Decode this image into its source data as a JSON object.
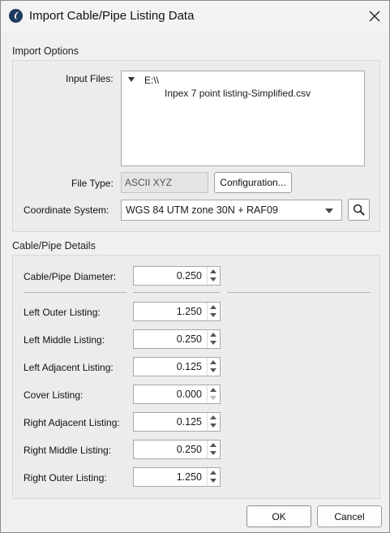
{
  "window": {
    "title": "Import Cable/Pipe Listing Data",
    "icon": "app-logo-icon",
    "close_icon": "close-icon"
  },
  "import_options": {
    "group_label": "Import Options",
    "input_files_label": "Input Files:",
    "tree": {
      "root": "E:\\\\",
      "file": "Inpex 7 point listing-Simplified.csv",
      "expander_icon": "tree-expanded-icon"
    },
    "file_type_label": "File Type:",
    "file_type_value": "ASCII XYZ",
    "configuration_button": "Configuration...",
    "coordinate_system_label": "Coordinate System:",
    "coordinate_system_value": "WGS 84 UTM zone 30N + RAF09",
    "search_icon": "search-icon"
  },
  "cable_details": {
    "group_label": "Cable/Pipe Details",
    "diameter": {
      "label": "Cable/Pipe Diameter:",
      "value": "0.250"
    },
    "fields": [
      {
        "label": "Left Outer Listing:",
        "value": "1.250"
      },
      {
        "label": "Left Middle Listing:",
        "value": "0.250"
      },
      {
        "label": "Left Adjacent Listing:",
        "value": "0.125"
      },
      {
        "label": "Cover Listing:",
        "value": "0.000"
      },
      {
        "label": "Right Adjacent Listing:",
        "value": "0.125"
      },
      {
        "label": "Right Middle Listing:",
        "value": "0.250"
      },
      {
        "label": "Right Outer Listing:",
        "value": "1.250"
      }
    ]
  },
  "footer": {
    "ok_label": "OK",
    "cancel_label": "Cancel"
  }
}
